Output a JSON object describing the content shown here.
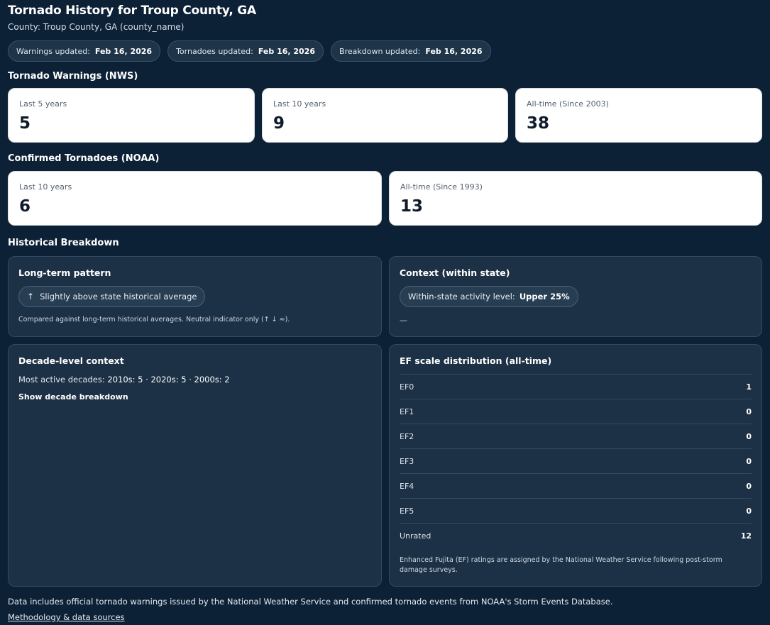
{
  "header": {
    "title": "Tornado History for Troup County, GA",
    "subtitle": "County: Troup County, GA (county_name)"
  },
  "updates": [
    {
      "label": "Warnings updated:",
      "value": "Feb 16, 2026"
    },
    {
      "label": "Tornadoes updated:",
      "value": "Feb 16, 2026"
    },
    {
      "label": "Breakdown updated:",
      "value": "Feb 16, 2026"
    }
  ],
  "warnings": {
    "heading": "Tornado Warnings (NWS)",
    "cards": [
      {
        "label": "Last 5 years",
        "value": "5"
      },
      {
        "label": "Last 10 years",
        "value": "9"
      },
      {
        "label": "All-time (Since 2003)",
        "value": "38"
      }
    ]
  },
  "tornadoes": {
    "heading": "Confirmed Tornadoes (NOAA)",
    "cards": [
      {
        "label": "Last 10 years",
        "value": "6"
      },
      {
        "label": "All-time (Since 1993)",
        "value": "13"
      }
    ]
  },
  "breakdown": {
    "heading": "Historical Breakdown",
    "long_term": {
      "title": "Long-term pattern",
      "arrow": "↑",
      "pill": "Slightly above state historical average",
      "note": "Compared against long-term historical averages. Neutral indicator only (↑ ↓ ≈)."
    },
    "context": {
      "title": "Context (within state)",
      "pill_label": "Within-state activity level:",
      "pill_value": "Upper 25%",
      "dash": "—"
    },
    "decade": {
      "title": "Decade-level context",
      "prefix": "Most active decades: ",
      "decades": "2010s: 5 · 2020s: 5 · 2000s: 2",
      "toggle": "Show decade breakdown"
    },
    "ef": {
      "title": "EF scale distribution (all-time)",
      "rows": [
        {
          "label": "EF0",
          "count": "1"
        },
        {
          "label": "EF1",
          "count": "0"
        },
        {
          "label": "EF2",
          "count": "0"
        },
        {
          "label": "EF3",
          "count": "0"
        },
        {
          "label": "EF4",
          "count": "0"
        },
        {
          "label": "EF5",
          "count": "0"
        },
        {
          "label": "Unrated",
          "count": "12"
        }
      ],
      "note_line1": "Enhanced Fujita (EF) ratings are assigned by the National Weather Service following post-storm",
      "note_line2": "damage surveys."
    }
  },
  "footer": {
    "text": "Data includes official tornado warnings issued by the National Weather Service and confirmed tornado events from NOAA's Storm Events Database.",
    "link": "Methodology & data sources"
  }
}
